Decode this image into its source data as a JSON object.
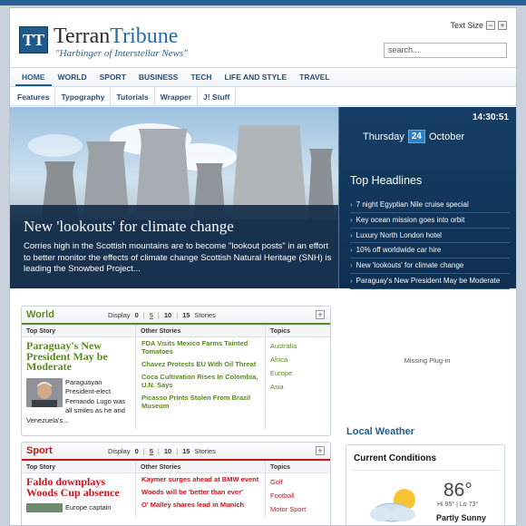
{
  "header": {
    "logo_letters": "TT",
    "brand_part1": "Terran",
    "brand_part2": "Tribune",
    "tagline": "\"Harbinger of Interstellar News\"",
    "text_size_label": "Text Size",
    "text_size_minus": "−",
    "text_size_plus": "+",
    "search_placeholder": "search..."
  },
  "nav": {
    "items": [
      {
        "label": "HOME"
      },
      {
        "label": "WORLD"
      },
      {
        "label": "SPORT"
      },
      {
        "label": "BUSINESS"
      },
      {
        "label": "TECH"
      },
      {
        "label": "LIFE AND STYLE"
      },
      {
        "label": "TRAVEL"
      }
    ],
    "active_index": 0
  },
  "subnav": {
    "items": [
      {
        "label": "Features"
      },
      {
        "label": "Typography"
      },
      {
        "label": "Tutorials"
      },
      {
        "label": "Wrapper"
      },
      {
        "label": "J! Stuff"
      }
    ]
  },
  "hero": {
    "title": "New 'lookouts' for climate change",
    "description": "Corries high in the Scottish mountains are to become \"lookout posts\" in an effort to better monitor the effects of climate change Scottish Natural Heritage (SNH) is leading the Snowbed Project..."
  },
  "headlines": {
    "time": "14:30:51",
    "day": "Thursday",
    "date_num": "24",
    "month": "October",
    "title": "Top Headlines",
    "items": [
      {
        "label": "7 night Egyptian Nile cruise special"
      },
      {
        "label": "Key ocean mission goes into orbit"
      },
      {
        "label": "Luxury North London hotel"
      },
      {
        "label": "10% off worldwide car hire"
      },
      {
        "label": "New 'lookouts' for climate change"
      },
      {
        "label": "Paraguay's New President May be Moderate"
      }
    ]
  },
  "display_control": {
    "label": "Display",
    "options": [
      "0",
      "5",
      "10",
      "15"
    ],
    "selected": "5",
    "suffix": "Stories"
  },
  "column_headers": {
    "top": "Top Story",
    "other": "Other Stories",
    "topics": "Topics"
  },
  "world": {
    "name": "World",
    "accent": "#5a8a1f",
    "top_title": "Paraguay's New President May be Moderate",
    "top_body": "Paraguayan President-elect Fernando Lugo was all smiles as he and Venezuela's...",
    "other_stories": [
      {
        "label": "FDA Visits Mexico Farms Tainted Tomatoes"
      },
      {
        "label": "Chavez Protests EU With Oil Threat"
      },
      {
        "label": "Coca Cultivation Rises In Colombia, U.N. Says"
      },
      {
        "label": "Picasso Prints Stolen From Brazil Museum"
      }
    ],
    "topics": [
      {
        "label": "Australia"
      },
      {
        "label": "Africa"
      },
      {
        "label": "Europe"
      },
      {
        "label": "Asia"
      }
    ]
  },
  "sport": {
    "name": "Sport",
    "accent": "#c8161d",
    "top_title": "Faldo downplays Woods Cup absence",
    "top_body": "Europe captain",
    "other_stories": [
      {
        "label": "Kaymer surges ahead at BMW event"
      },
      {
        "label": "Woods will be 'better than ever'"
      },
      {
        "label": "O' Malley shares lead in Munich"
      }
    ],
    "topics": [
      {
        "label": "Golf"
      },
      {
        "label": "Football"
      },
      {
        "label": "Motor Sport"
      }
    ]
  },
  "plugin": {
    "missing_label": "Missing Plug-in"
  },
  "weather": {
    "section_title": "Local Weather",
    "card_title": "Current Conditions",
    "temp": "86°",
    "hilo": "Hi 95° | Lo 73°",
    "condition": "Partly Sunny",
    "icon": "partly-sunny-icon"
  }
}
